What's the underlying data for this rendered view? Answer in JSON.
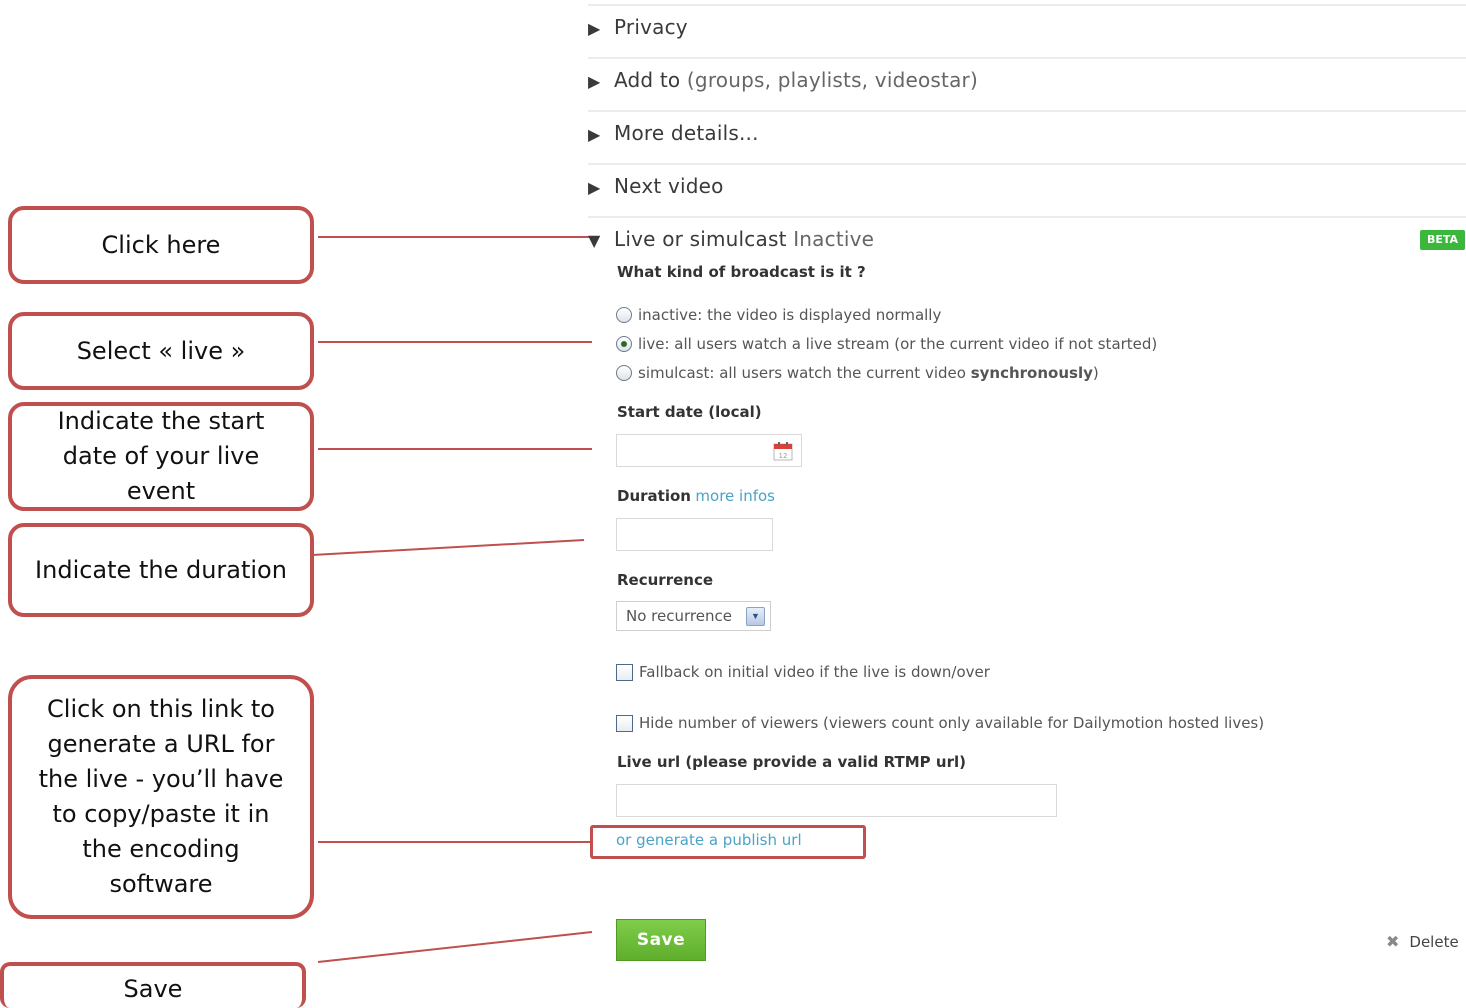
{
  "sections": [
    {
      "label": "Privacy",
      "muted": ""
    },
    {
      "label": "Add to",
      "muted": "(groups, playlists, videostar)"
    },
    {
      "label": "More details...",
      "muted": ""
    },
    {
      "label": "Next video",
      "muted": ""
    }
  ],
  "live": {
    "title": "Live or simulcast",
    "status": "Inactive",
    "badge": "BETA",
    "question": "What kind of broadcast is it ?",
    "options": [
      {
        "text": "inactive: the video is displayed normally",
        "checked": false
      },
      {
        "text": "live: all users watch a live stream (or the current video if not started)",
        "checked": true
      },
      {
        "text_prefix": "simulcast: all users watch the current video ",
        "text_bold": "synchronously",
        "text_suffix": ")",
        "checked": false
      }
    ],
    "start_date_label": "Start date (local)",
    "start_date_value": "",
    "duration_label": "Duration",
    "duration_link": "more infos",
    "duration_value": "",
    "recurrence_label": "Recurrence",
    "recurrence_value": "No recurrence",
    "fallback_label": "Fallback on initial video if the live is down/over",
    "hide_viewers_label": "Hide number of viewers (viewers count only available for Dailymotion hosted lives)",
    "live_url_label": "Live url (please provide a valid RTMP url)",
    "live_url_value": "",
    "generate_link": "or generate a publish url",
    "save_label": "Save",
    "delete_label": "Delete"
  },
  "callouts": {
    "click_here": "Click here",
    "select_live": "Select « live »",
    "start_date": "Indicate the start date of your live event",
    "duration": "Indicate the duration",
    "generate_url": "Click on this link to generate a URL for the live - you’ll have to copy/paste it in the encoding software",
    "save": "Save"
  },
  "colors": {
    "callout_border": "#c0504d",
    "link": "#4aa3c8",
    "save_green": "#6cbd38",
    "beta_green": "#3bb83b"
  }
}
